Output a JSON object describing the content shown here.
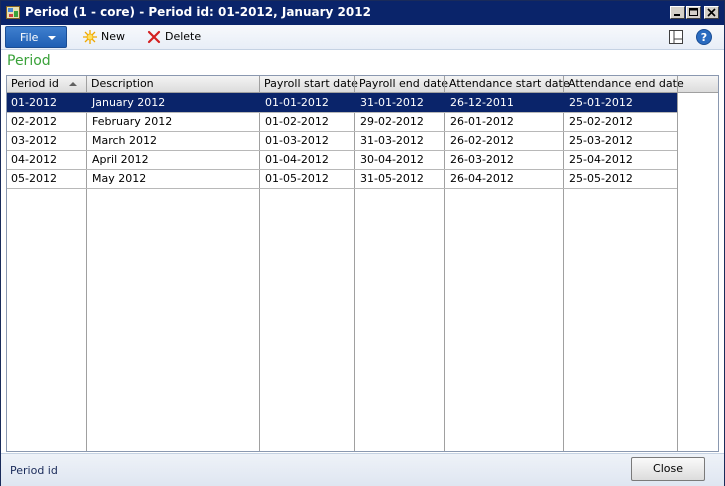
{
  "window": {
    "title": "Period (1 - core) - Period id: 01-2012, January 2012"
  },
  "toolbar": {
    "file_label": "File",
    "new_label": "New",
    "delete_label": "Delete"
  },
  "section": {
    "title": "Period"
  },
  "grid": {
    "columns": [
      "Period id",
      "Description",
      "Payroll start date",
      "Payroll end date",
      "Attendance start date",
      "Attendance end date"
    ],
    "rows": [
      [
        "01-2012",
        "January 2012",
        "01-01-2012",
        "31-01-2012",
        "26-12-2011",
        "25-01-2012"
      ],
      [
        "02-2012",
        "February 2012",
        "01-02-2012",
        "29-02-2012",
        "26-01-2012",
        "25-02-2012"
      ],
      [
        "03-2012",
        "March 2012",
        "01-03-2012",
        "31-03-2012",
        "26-02-2012",
        "25-03-2012"
      ],
      [
        "04-2012",
        "April 2012",
        "01-04-2012",
        "30-04-2012",
        "26-03-2012",
        "25-04-2012"
      ],
      [
        "05-2012",
        "May 2012",
        "01-05-2012",
        "31-05-2012",
        "26-04-2012",
        "25-05-2012"
      ]
    ],
    "selected_row": 0
  },
  "status": {
    "text": "Period id",
    "close_label": "Close"
  },
  "icons": {
    "app": "app-icon",
    "new": "new-icon",
    "delete": "delete-icon",
    "layout": "layout-icon",
    "help": "help-icon",
    "sort": "sort-ascending-icon"
  },
  "colors": {
    "titlebar": "#0a246a",
    "selection": "#0a246a",
    "section_title": "#3aa23a",
    "file_button": "#2a6bc0"
  }
}
